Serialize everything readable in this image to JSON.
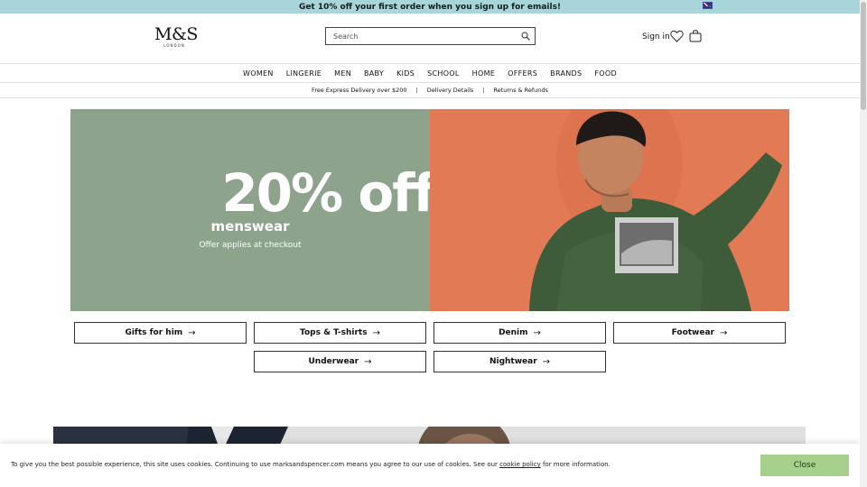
{
  "promo": {
    "text": "Get 10% off your first order when you sign up for emails!",
    "flag": "new-zealand-flag"
  },
  "header": {
    "logo_mark": "M&S",
    "logo_sub": "LONDON",
    "search_placeholder": "Search",
    "sign_in": "Sign in",
    "icons": [
      "search-icon",
      "heart-icon",
      "bag-icon"
    ]
  },
  "nav": {
    "items": [
      {
        "label": "WOMEN"
      },
      {
        "label": "LINGERIE"
      },
      {
        "label": "MEN"
      },
      {
        "label": "BABY"
      },
      {
        "label": "KIDS"
      },
      {
        "label": "SCHOOL"
      },
      {
        "label": "HOME"
      },
      {
        "label": "OFFERS"
      },
      {
        "label": "BRANDS"
      },
      {
        "label": "FOOD"
      }
    ]
  },
  "service": {
    "delivery": "Free Express Delivery over $200",
    "details": "Delivery Details",
    "returns": "Returns & Refunds"
  },
  "hero": {
    "headline": "20% off",
    "sub": "menswear",
    "note": "Offer applies at checkout"
  },
  "categories": [
    {
      "label": "Gifts for him"
    },
    {
      "label": "Tops & T-shirts"
    },
    {
      "label": "Denim"
    },
    {
      "label": "Footwear"
    },
    {
      "label": "Underwear"
    },
    {
      "label": "Nightwear"
    }
  ],
  "cookie": {
    "text_before": "To give you the best possible experience, this site uses cookies. Continuing to use marksandspencer.com means you agree to our use of cookies. See our ",
    "link": "cookie policy",
    "text_after": " for more information.",
    "close": "Close"
  },
  "colors": {
    "promo_bg": "#a7d5d9",
    "hero_left": "#8da38b",
    "hero_right": "#e27a55",
    "close_button": "#a8d08d"
  }
}
